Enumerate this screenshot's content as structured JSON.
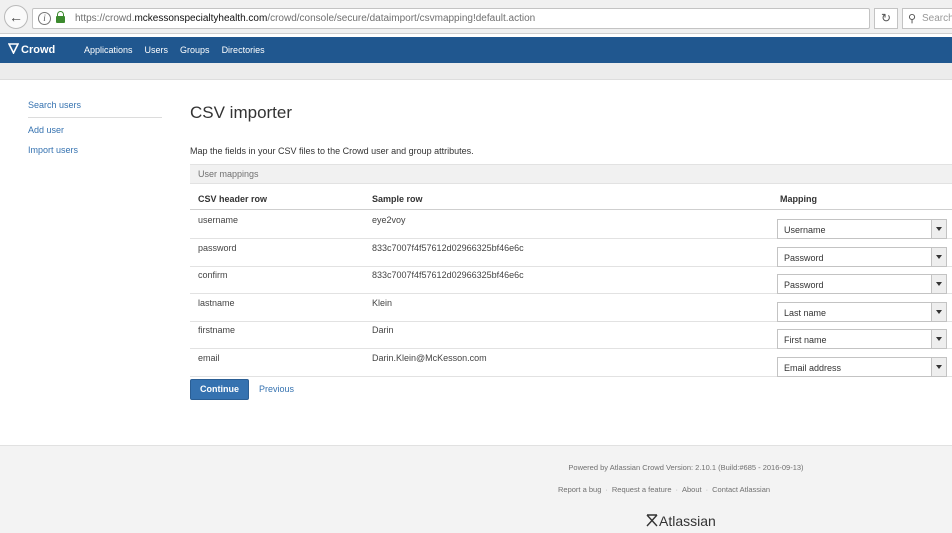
{
  "browser": {
    "url_prefix": "https://crowd.",
    "url_domain": "mckessonspecialtyhealth.com",
    "url_path": "/crowd/console/secure/dataimport/csvmapping!default.action",
    "search_placeholder": "Search"
  },
  "header": {
    "logo": "Crowd",
    "nav": [
      "Applications",
      "Users",
      "Groups",
      "Directories"
    ]
  },
  "sidebar": {
    "items": [
      {
        "label": "Search users"
      },
      {
        "label": "Add user"
      },
      {
        "label": "Import users"
      }
    ]
  },
  "main": {
    "title": "CSV importer",
    "description": "Map the fields in your CSV files to the Crowd user and group attributes.",
    "section_label": "User mappings",
    "columns": [
      "CSV header row",
      "Sample row",
      "Mapping"
    ],
    "rows": [
      {
        "header": "username",
        "sample": "eye2voy",
        "mapping": "Username"
      },
      {
        "header": "password",
        "sample": "833c7007f4f57612d02966325bf46e6c",
        "mapping": "Password"
      },
      {
        "header": "confirm",
        "sample": "833c7007f4f57612d02966325bf46e6c",
        "mapping": "Password"
      },
      {
        "header": "lastname",
        "sample": "Klein",
        "mapping": "Last name"
      },
      {
        "header": "firstname",
        "sample": "Darin",
        "mapping": "First name"
      },
      {
        "header": "email",
        "sample": "Darin.Klein@McKesson.com",
        "mapping": "Email address"
      }
    ],
    "continue_label": "Continue",
    "previous_label": "Previous"
  },
  "footer": {
    "powered_by": "Powered by Atlassian Crowd Version: 2.10.1 (Build:#685 - 2016-09-13)",
    "links": [
      "Report a bug",
      "Request a feature",
      "About",
      "Contact Atlassian"
    ],
    "brand": "Atlassian"
  },
  "colors": {
    "header_bg": "#20578f",
    "link": "#3572b0",
    "button": "#3572b0"
  }
}
